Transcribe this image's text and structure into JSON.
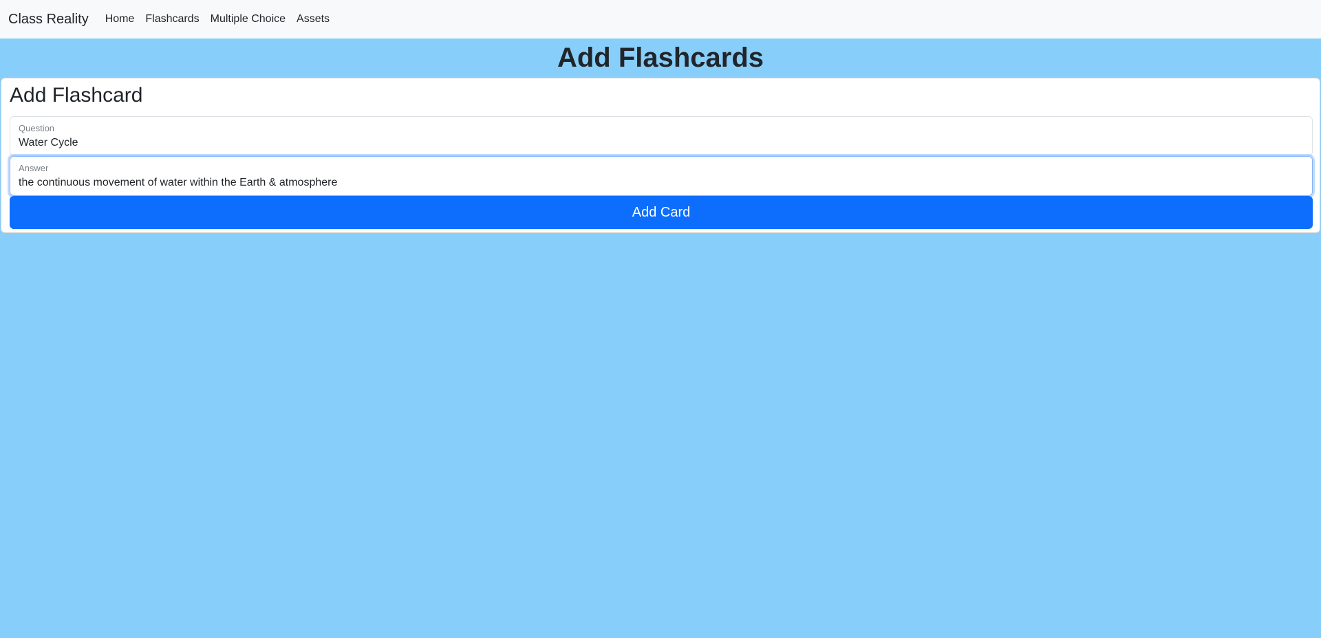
{
  "navbar": {
    "brand": "Class Reality",
    "links": [
      {
        "label": "Home"
      },
      {
        "label": "Flashcards"
      },
      {
        "label": "Multiple Choice"
      },
      {
        "label": "Assets"
      }
    ]
  },
  "page": {
    "title": "Add Flashcards",
    "background_color": "#87cefa"
  },
  "form": {
    "title": "Add Flashcard",
    "question": {
      "label": "Question",
      "value": "Water Cycle"
    },
    "answer": {
      "label": "Answer",
      "value": "the continuous movement of water within the Earth & atmosphere"
    },
    "submit_label": "Add Card",
    "submit_color": "#0d6efd"
  }
}
